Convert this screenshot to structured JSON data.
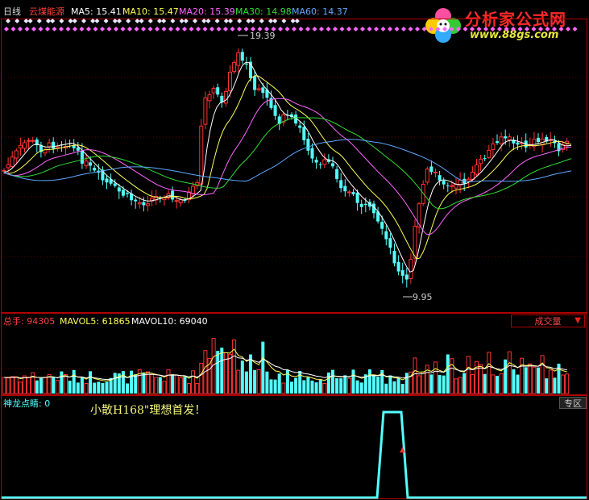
{
  "header": {
    "period": "日线",
    "stock_name": "云煤能源",
    "ma5": "MA5: 15.41",
    "ma10": "MA10: 15.47",
    "ma20": "MA20: 15.39",
    "ma30": "MA30: 14.98",
    "ma60": "MA60: 14.37"
  },
  "price_annotations": {
    "high": "19.39",
    "low": "9.95"
  },
  "volume": {
    "total": "总手: 94305",
    "mavol5": "MAVOL5: 61865",
    "mavol10": "MAVOL10: 69040",
    "indicator_select": "成交量"
  },
  "indicator": {
    "name": "神龙点睛: 0",
    "zone_button": "专区",
    "stamp_text": "小散H168\"理想首发！"
  },
  "watermark": {
    "title": "分析家公式网",
    "url": "www.88gs.com"
  },
  "colors": {
    "up": "#ff3333",
    "down": "#54ffff",
    "ma5": "#ffffff",
    "ma10": "#ffff55",
    "ma20": "#ff66ff",
    "ma30": "#33dd33",
    "ma60": "#5fa8ff",
    "frame": "#b00000"
  }
}
